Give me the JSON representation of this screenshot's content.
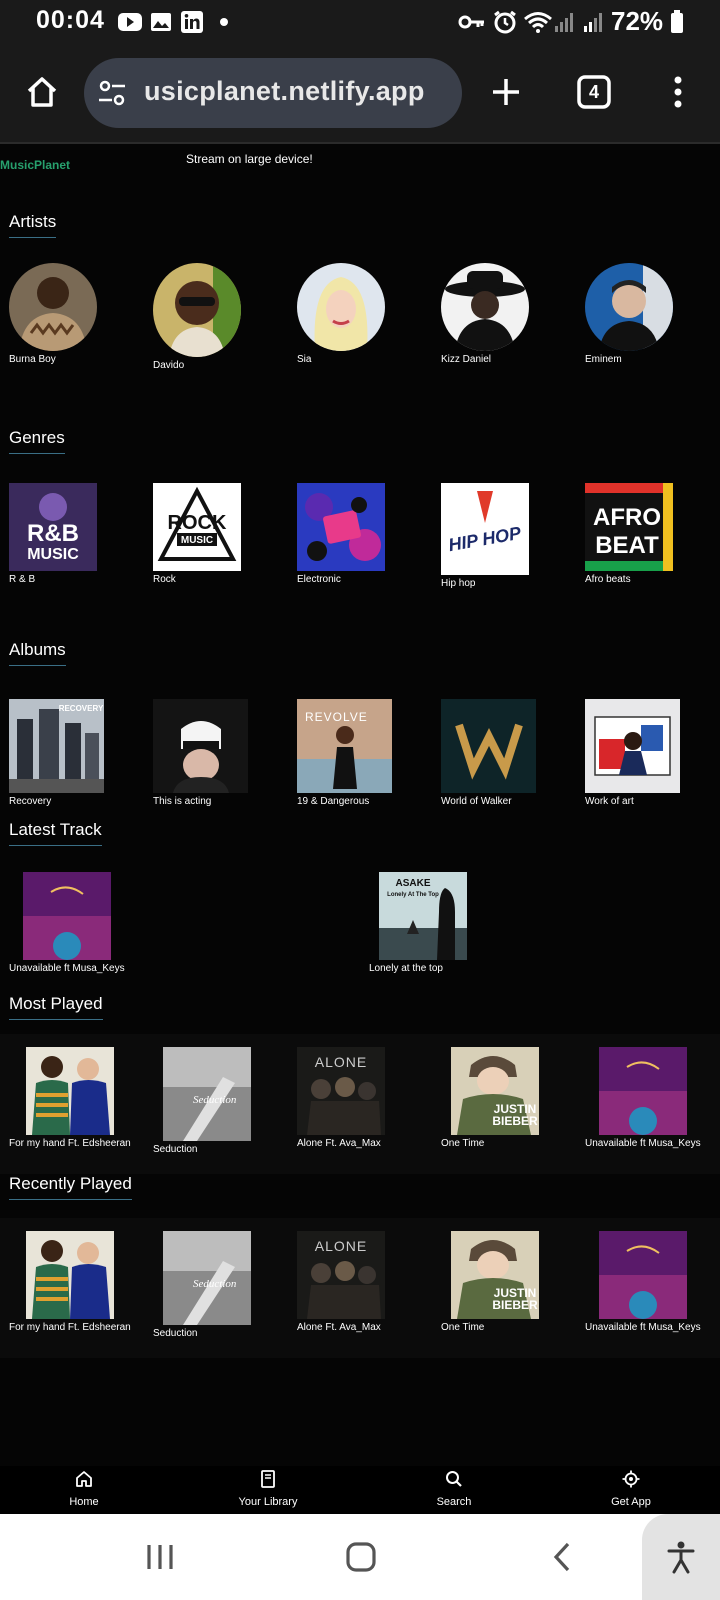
{
  "status": {
    "time": "00:04",
    "battery": "72%"
  },
  "browser": {
    "url": "usicplanet.netlify.app",
    "tab_count": "4"
  },
  "header": {
    "brand": "MusicPlanet",
    "notice": "Stream on large device!"
  },
  "sections": {
    "artists": {
      "title": "Artists",
      "items": [
        "Burna Boy",
        "Davido",
        "Sia",
        "Kizz Daniel",
        "Eminem"
      ]
    },
    "genres": {
      "title": "Genres",
      "items": [
        "R & B",
        "Rock",
        "Electronic",
        "Hip hop",
        "Afro beats"
      ]
    },
    "albums": {
      "title": "Albums",
      "items": [
        "Recovery",
        "This is acting",
        "19 & Dangerous",
        "World of Walker",
        "Work of art"
      ]
    },
    "latest": {
      "title": "Latest Track",
      "items": [
        "Unavailable ft Musa_Keys",
        "Lonely at the top"
      ]
    },
    "most_played": {
      "title": "Most Played",
      "items": [
        "For my hand Ft. Edsheeran",
        "Seduction",
        "Alone Ft. Ava_Max",
        "One Time",
        "Unavailable ft Musa_Keys"
      ]
    },
    "recent": {
      "title": "Recently Played",
      "items": [
        "For my hand Ft. Edsheeran",
        "Seduction",
        "Alone Ft. Ava_Max",
        "One Time",
        "Unavailable ft Musa_Keys"
      ]
    }
  },
  "art_text": {
    "rnb": "R&B",
    "rnb_sub": "MUSIC",
    "rock": "ROCK",
    "rock_sub": "MUSIC",
    "hiphop": "HIP HOP",
    "afro": "AFRO",
    "beat": "BEAT",
    "revolve": "REVOLVE",
    "recovery": "RECOVERY",
    "alone": "ALONE",
    "justin": "JUSTIN",
    "bieber": "BIEBER",
    "seduction": "Seduction",
    "asake": "ASAKE",
    "asake_sub": "Lonely At The Top"
  },
  "nav": {
    "home": "Home",
    "library": "Your Library",
    "search": "Search",
    "get_app": "Get App"
  }
}
